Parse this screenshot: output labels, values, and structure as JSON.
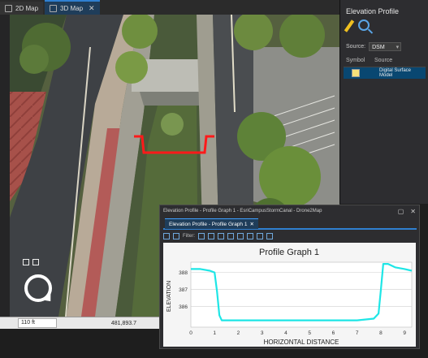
{
  "tabs": [
    {
      "label": "2D Map",
      "active": false
    },
    {
      "label": "3D Map",
      "active": true
    }
  ],
  "tab_close_glyph": "✕",
  "map_status": {
    "scale": "110 ft",
    "coordinate": "481,893.7"
  },
  "elevation_pane": {
    "title": "Elevation Profile",
    "source_label": "Source:",
    "source_value": "DSM",
    "columns": [
      "Symbol",
      "Source"
    ],
    "rows": [
      {
        "source": "Digital Surface Model",
        "swatch_color": "#f5e07a"
      }
    ]
  },
  "profile_window": {
    "title": "Elevation Profile - Profile Graph 1 - EsriCampusStormCanal - Drone2Map",
    "tab_label": "Elevation Profile - Profile Graph 1",
    "filter_label": "Filter:"
  },
  "icons": [
    "pencil-icon",
    "magnify-icon",
    "pan-icon",
    "zoom-icon",
    "navigator-wheel-icon"
  ],
  "chart_data": {
    "type": "line",
    "title": "Profile Graph 1",
    "xlabel": "HORIZONTAL DISTANCE",
    "ylabel": "ELEVATION",
    "xlim": [
      0,
      9.3
    ],
    "ylim": [
      384.8,
      388.6
    ],
    "xticks": [
      0,
      1,
      2,
      3,
      4,
      5,
      6,
      7,
      8,
      9
    ],
    "yticks": [
      386,
      387,
      388
    ],
    "grid": true,
    "line_color": "#1ee6e6",
    "series": [
      {
        "x": [
          0,
          0.4,
          0.8,
          1.0,
          1.1,
          1.2,
          1.3,
          1.5,
          2,
          3,
          4,
          5,
          6,
          7,
          7.7,
          7.9,
          8.0,
          8.1,
          8.3,
          8.6,
          9.0,
          9.3
        ],
        "y": [
          388.2,
          388.2,
          388.1,
          388.0,
          386.9,
          385.5,
          385.2,
          385.2,
          385.2,
          385.2,
          385.2,
          385.2,
          385.2,
          385.2,
          385.3,
          385.6,
          387.0,
          388.5,
          388.5,
          388.3,
          388.2,
          388.1
        ]
      }
    ]
  },
  "colors": {
    "accent": "#2f80d1",
    "profile_line": "#ff1a1a"
  }
}
